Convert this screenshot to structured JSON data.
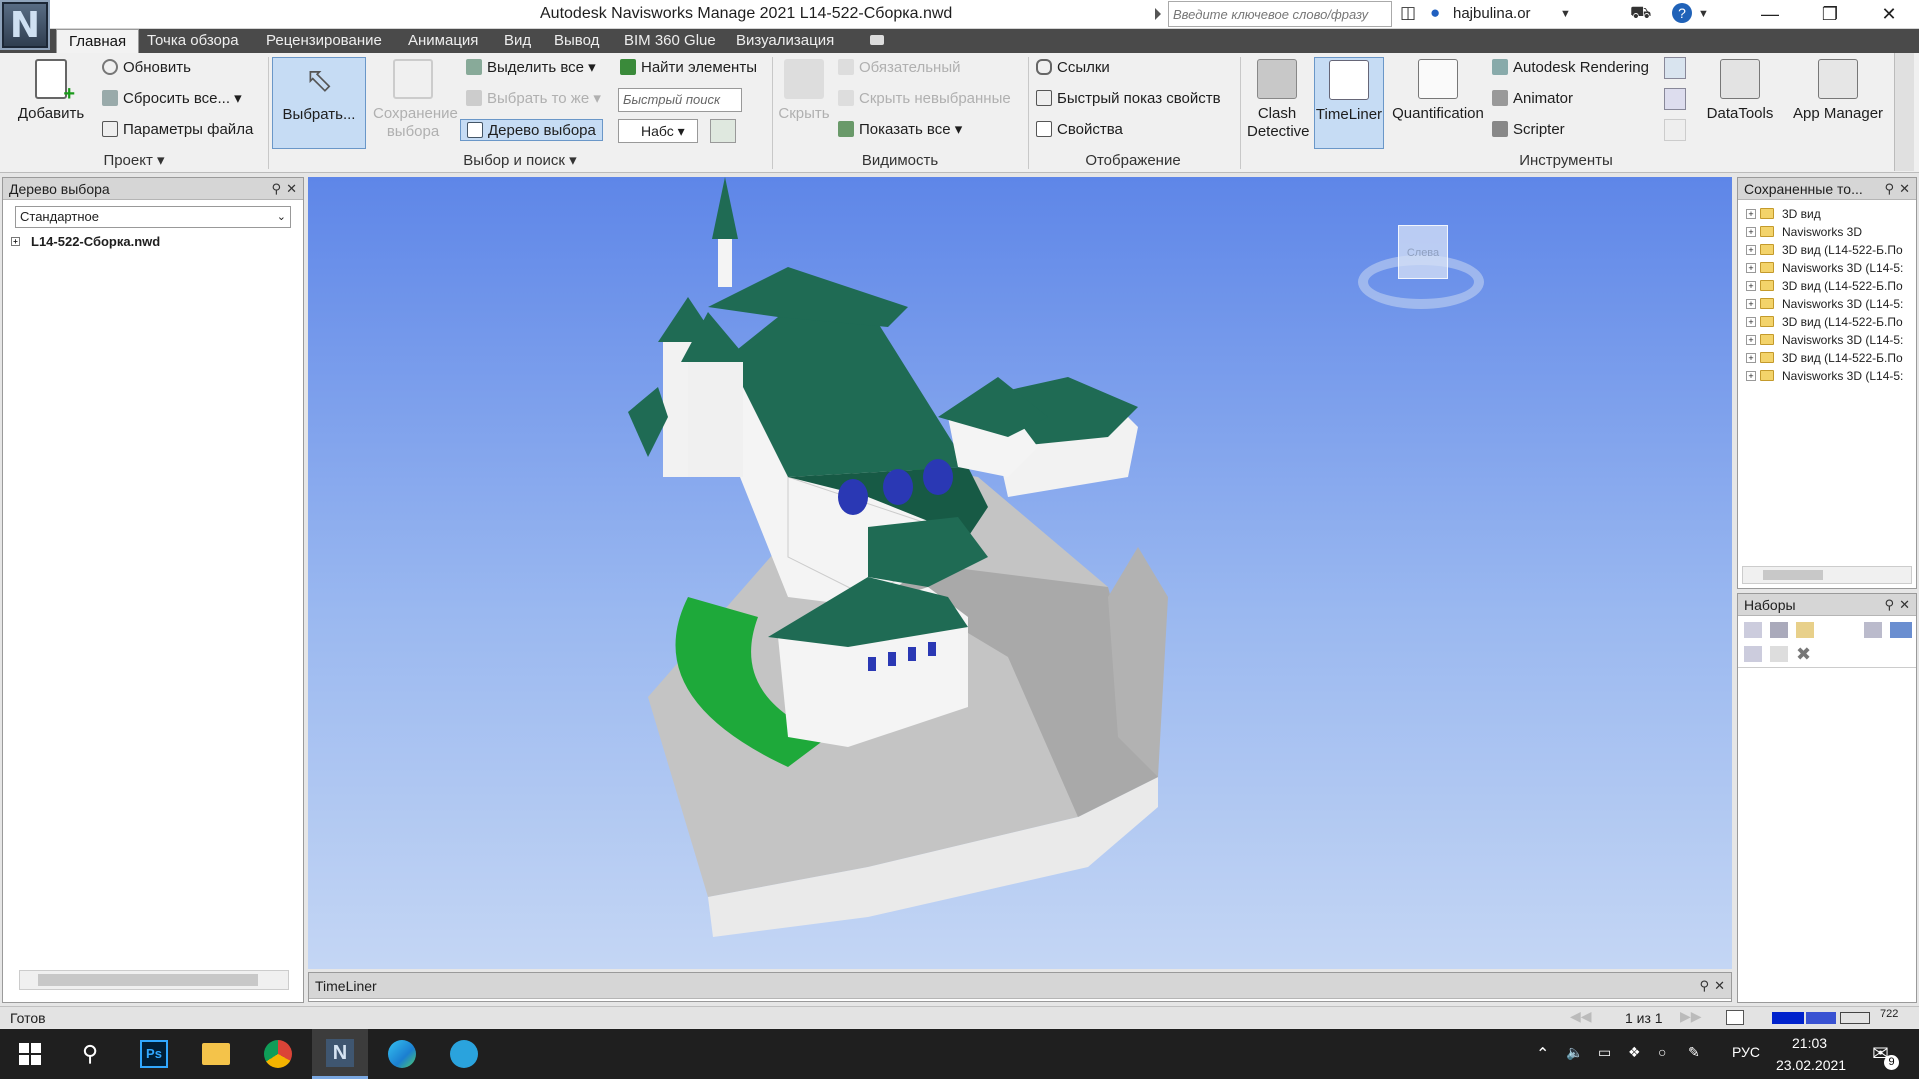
{
  "window": {
    "title": "Autodesk Navisworks Manage 2021    L14-522-Сборка.nwd",
    "logo": "N",
    "search_placeholder": "Введите ключевое слово/фразу",
    "user": "hajbulina.or"
  },
  "tabs": [
    "Главная",
    "Точка обзора",
    "Рецензирование",
    "Анимация",
    "Вид",
    "Вывод",
    "BIM 360 Glue",
    "Визуализация"
  ],
  "ribbon": {
    "project": {
      "add": "Добавить",
      "refresh": "Обновить",
      "reset": "Сбросить все...",
      "file_options": "Параметры файла",
      "label": "Проект"
    },
    "select": {
      "select": "Выбрать...",
      "save_selection": "Сохранение выбора",
      "select_all": "Выделить все",
      "select_same": "Выбрать то же",
      "selection_tree": "Дерево выбора",
      "find_items": "Найти элементы",
      "quick_find": "Быстрый поиск",
      "sets": "Набс",
      "label": "Выбор и поиск"
    },
    "visibility": {
      "hide": "Скрыть",
      "required": "Обязательный",
      "hide_unselected": "Скрыть невыбранные",
      "show_all": "Показать все",
      "label": "Видимость"
    },
    "display": {
      "links": "Ссылки",
      "quick_properties": "Быстрый показ свойств",
      "properties": "Свойства",
      "label": "Отображение"
    },
    "tools": {
      "clash": "Clash Detective",
      "timeliner": "TimeLiner",
      "quantification": "Quantification",
      "rendering": "Autodesk Rendering",
      "animator": "Animator",
      "scripter": "Scripter",
      "datatools": "DataTools",
      "app_manager": "App Manager",
      "label": "Инструменты"
    }
  },
  "selection_tree": {
    "title": "Дерево выбора",
    "mode": "Стандартное",
    "root": "L14-522-Сборка.nwd"
  },
  "saved_views": {
    "title": "Сохраненные то...",
    "items": [
      "3D вид",
      "Navisworks 3D",
      "3D вид (L14-522-Б.По",
      "Navisworks 3D (L14-5:",
      "3D вид (L14-522-Б.По",
      "Navisworks 3D (L14-5:",
      "3D вид (L14-522-Б.По",
      "Navisworks 3D (L14-5:",
      "3D вид (L14-522-Б.По",
      "Navisworks 3D (L14-5:"
    ]
  },
  "sets_panel": {
    "title": "Наборы"
  },
  "timeliner_panel": {
    "title": "TimeLiner"
  },
  "viewcube": {
    "face": "Слева"
  },
  "status": {
    "text": "Готов",
    "page": "1 из 1",
    "memory": "722"
  },
  "taskbar": {
    "lang": "РУС",
    "time": "21:03",
    "date": "23.02.2021",
    "notifications": "9"
  },
  "colors": {
    "roof": "#1f6b54",
    "walls": "#f4f4f4",
    "lawn": "#1ea93a",
    "sky_top": "#5e86e8",
    "ground": "#c9c9c9"
  }
}
